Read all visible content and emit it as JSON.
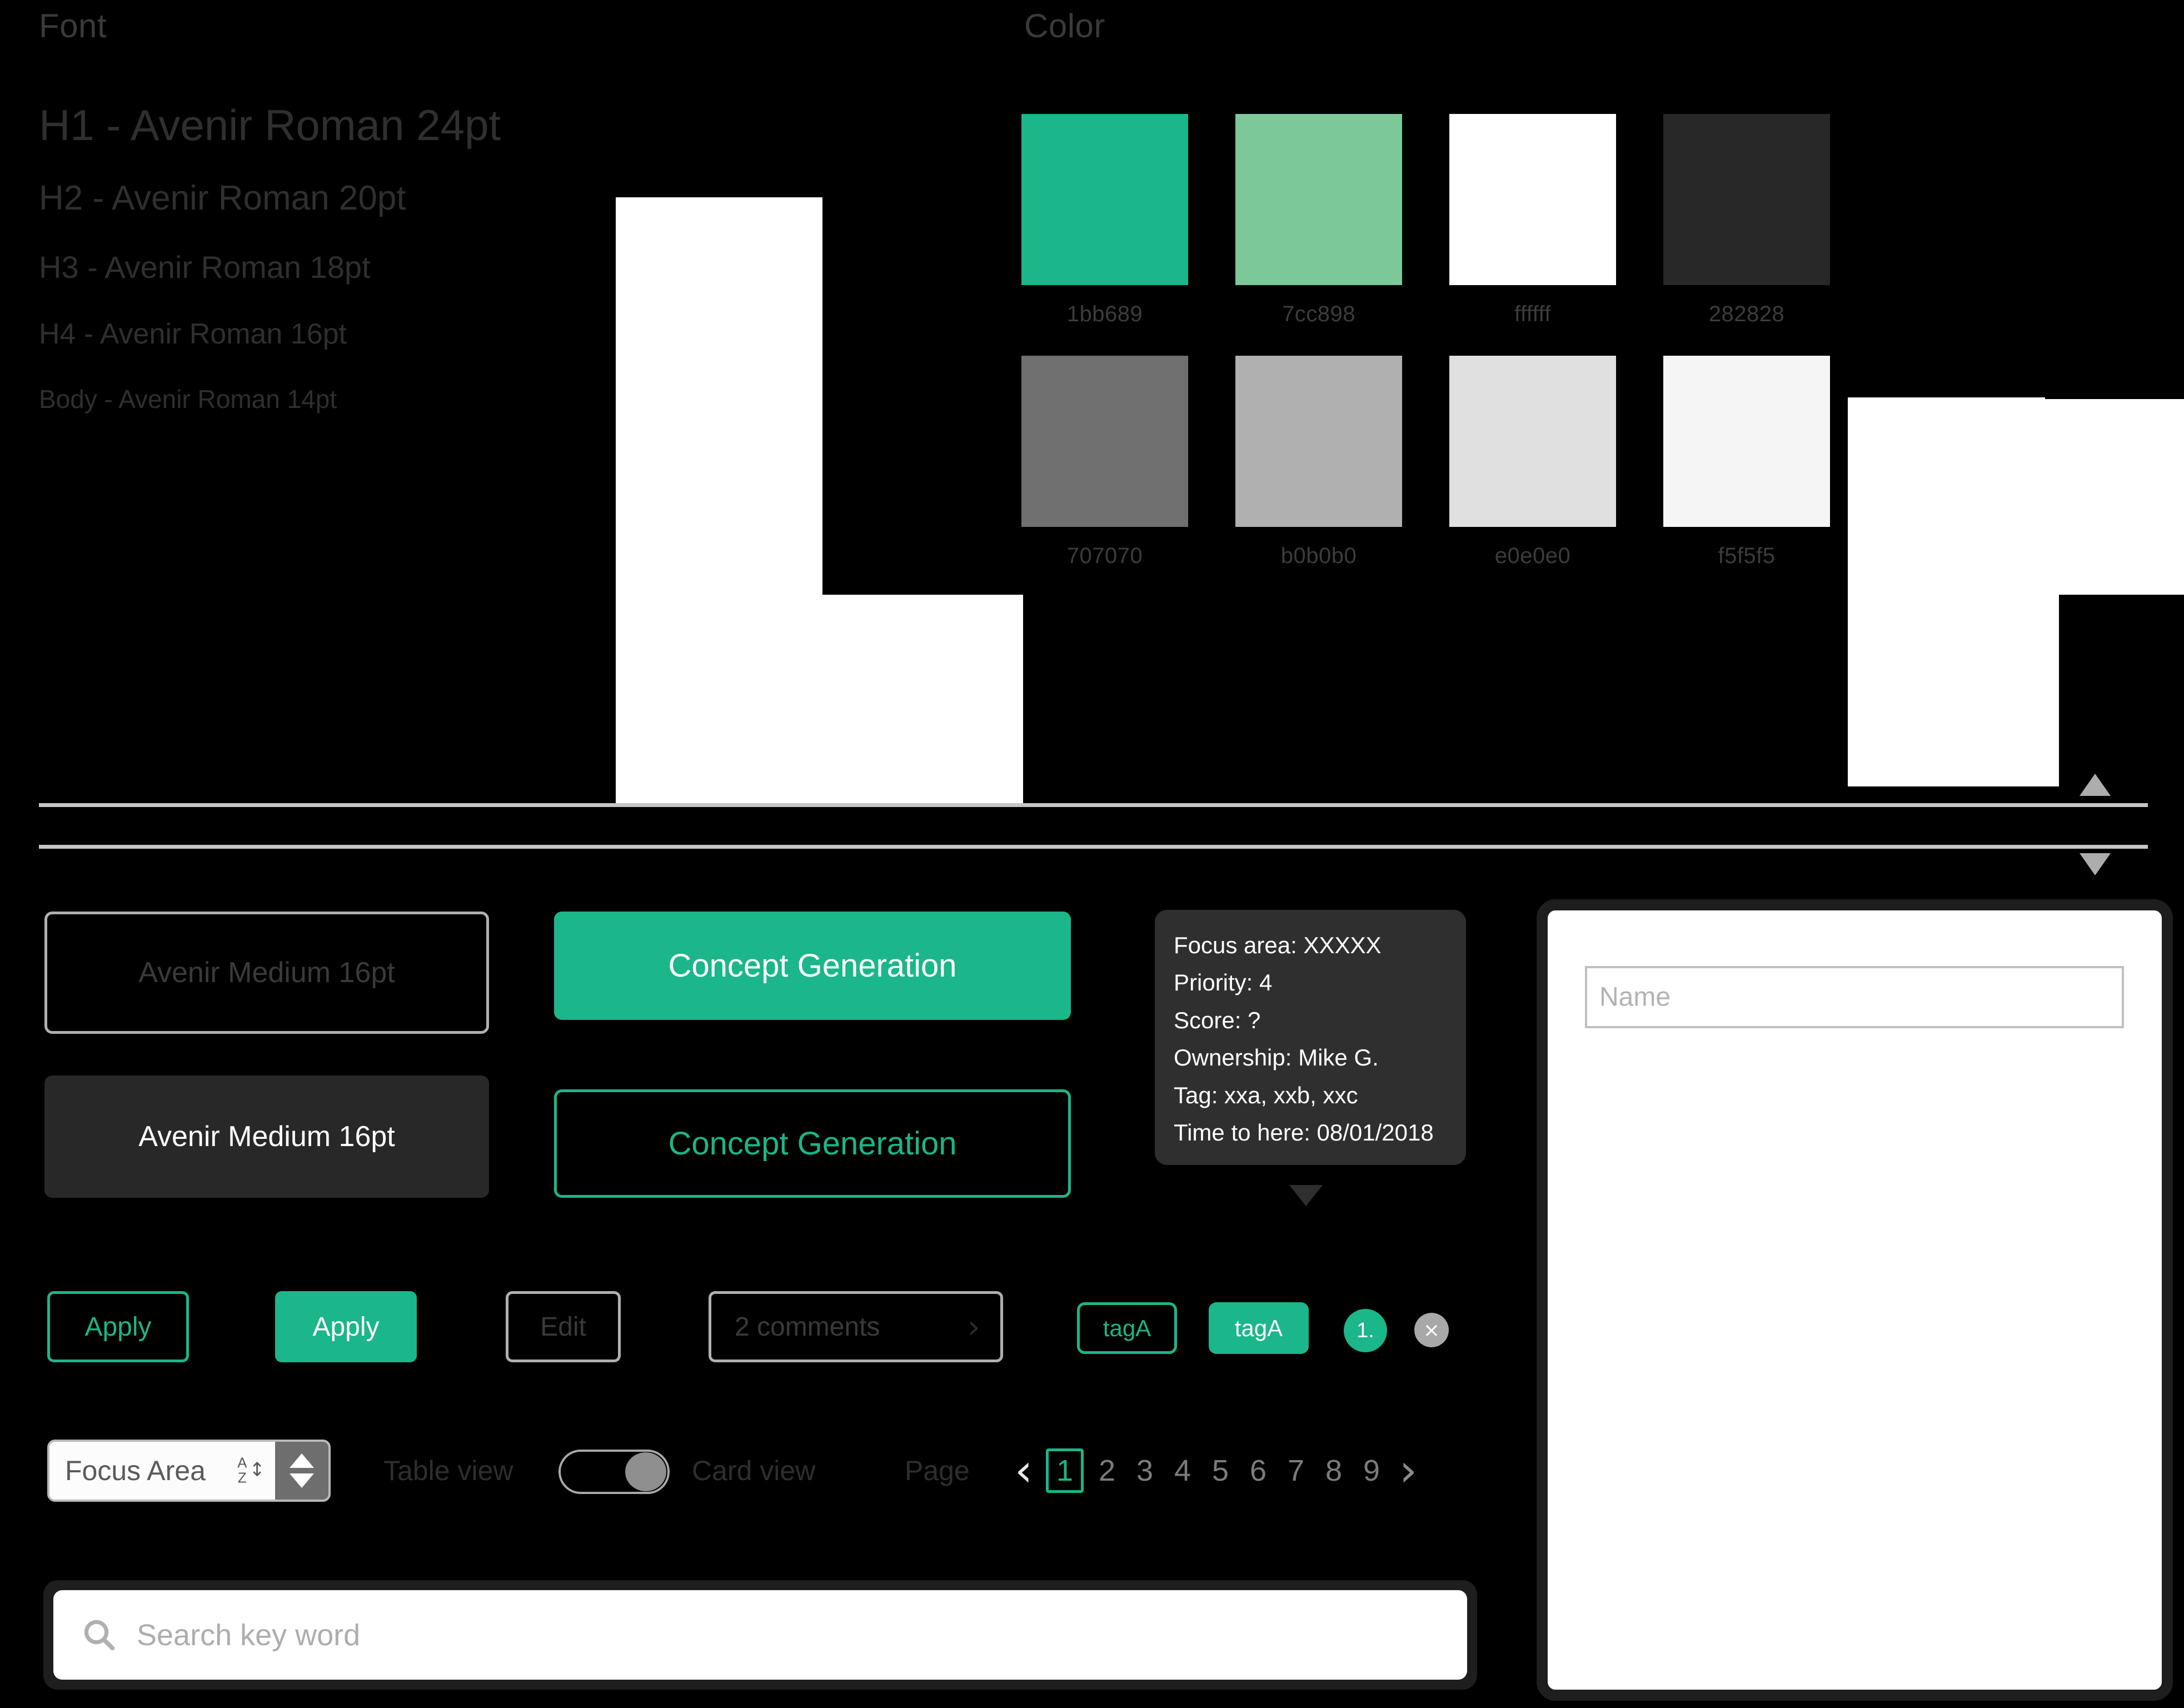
{
  "sections": {
    "font_title": "Font",
    "color_title": "Color"
  },
  "font_specs": [
    {
      "label": "H1 - Avenir Roman 24pt"
    },
    {
      "label": "H2 - Avenir Roman 20pt"
    },
    {
      "label": "H3 - Avenir Roman 18pt"
    },
    {
      "label": "H4 - Avenir Roman 16pt"
    },
    {
      "label": "Body - Avenir Roman 14pt"
    }
  ],
  "colors": [
    {
      "hex_label": "1bb689",
      "hex": "#1bb689"
    },
    {
      "hex_label": "7cc898",
      "hex": "#7cc898"
    },
    {
      "hex_label": "ffffff",
      "hex": "#ffffff"
    },
    {
      "hex_label": "282828",
      "hex": "#282828"
    },
    {
      "hex_label": "707070",
      "hex": "#707070"
    },
    {
      "hex_label": "b0b0b0",
      "hex": "#b0b0b0"
    },
    {
      "hex_label": "e0e0e0",
      "hex": "#e0e0e0"
    },
    {
      "hex_label": "f5f5f5",
      "hex": "#f5f5f5"
    }
  ],
  "buttons": {
    "outline_gray_label": "Avenir Medium 16pt",
    "solid_dark_label": "Avenir Medium 16pt",
    "solid_green_label": "Concept Generation",
    "outline_green_label": "Concept Generation"
  },
  "tooltip": {
    "lines": [
      "Focus area: XXXXX",
      "Priority: 4",
      "Score: ?",
      "Ownership: Mike G.",
      "Tag: xxa, xxb, xxc",
      "Time to here: 08/01/2018"
    ]
  },
  "right_panel": {
    "name_placeholder": "Name"
  },
  "actions": {
    "apply_outline_label": "Apply",
    "apply_solid_label": "Apply",
    "edit_label": "Edit",
    "comments_label": "2 comments",
    "comments_chevron": "›",
    "tag_outline_label": "tagA",
    "tag_solid_label": "tagA",
    "number_badge_label": "1.",
    "close_badge_label": "×"
  },
  "controls": {
    "sort_select_value": "Focus Area",
    "sort_letter_top": "A",
    "sort_letter_bottom": "Z",
    "sort_arrow": "↕",
    "table_view_label": "Table view",
    "card_view_label": "Card view",
    "page_label": "Page",
    "prev_chevron": "‹",
    "next_chevron": "›",
    "pages": [
      "1",
      "2",
      "3",
      "4",
      "5",
      "6",
      "7",
      "8",
      "9"
    ],
    "active_page": "1"
  },
  "search": {
    "placeholder": "Search key word"
  }
}
